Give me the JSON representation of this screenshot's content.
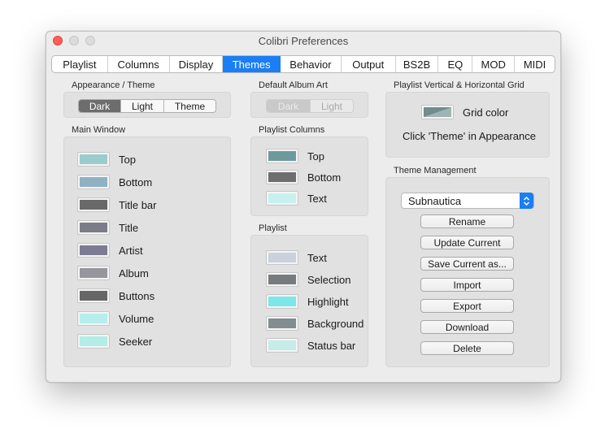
{
  "window": {
    "title": "Colibri Preferences"
  },
  "tabs": [
    {
      "label": "Playlist",
      "active": false
    },
    {
      "label": "Columns",
      "active": false
    },
    {
      "label": "Display",
      "active": false
    },
    {
      "label": "Themes",
      "active": true
    },
    {
      "label": "Behavior",
      "active": false
    },
    {
      "label": "Output",
      "active": false
    },
    {
      "label": "BS2B",
      "active": false
    },
    {
      "label": "EQ",
      "active": false
    },
    {
      "label": "MOD",
      "active": false
    },
    {
      "label": "MIDI",
      "active": false
    }
  ],
  "appearance": {
    "label": "Appearance / Theme",
    "options": [
      "Dark",
      "Light",
      "Theme"
    ],
    "selected": "Dark"
  },
  "main_window": {
    "label": "Main Window",
    "items": [
      {
        "label": "Top",
        "color": "#9ccbcb"
      },
      {
        "label": "Bottom",
        "color": "#8fb1c4"
      },
      {
        "label": "Title bar",
        "color": "#696969"
      },
      {
        "label": "Title",
        "color": "#7c7c88"
      },
      {
        "label": "Artist",
        "color": "#7d7b94"
      },
      {
        "label": "Album",
        "color": "#96969c"
      },
      {
        "label": "Buttons",
        "color": "#666666"
      },
      {
        "label": "Volume",
        "color": "#b6eeec"
      },
      {
        "label": "Seeker",
        "color": "#b2ede8"
      }
    ]
  },
  "default_album_art": {
    "label": "Default Album Art",
    "options": [
      "Dark",
      "Light"
    ],
    "selected": "Dark"
  },
  "playlist_columns": {
    "label": "Playlist Columns",
    "items": [
      {
        "label": "Top",
        "color": "#6e999c"
      },
      {
        "label": "Bottom",
        "color": "#6e6e6e"
      },
      {
        "label": "Text",
        "color": "#c7f1ee"
      }
    ]
  },
  "playlist": {
    "label": "Playlist",
    "items": [
      {
        "label": "Text",
        "color": "#c9d2da"
      },
      {
        "label": "Selection",
        "color": "#787b7e"
      },
      {
        "label": "Highlight",
        "color": "#7be7e9"
      },
      {
        "label": "Background",
        "color": "#818d8f"
      },
      {
        "label": "Status bar",
        "color": "#c5ece6"
      }
    ]
  },
  "grid": {
    "label": "Playlist Vertical & Horizontal Grid",
    "color_label": "Grid color",
    "color": "#6f8d8a",
    "hint": "Click 'Theme' in Appearance"
  },
  "theme_management": {
    "label": "Theme Management",
    "selected_theme": "Subnautica",
    "buttons": [
      "Rename",
      "Update Current",
      "Save Current as...",
      "Import",
      "Export",
      "Download",
      "Delete"
    ]
  },
  "colors": {
    "accent": "#1b7ef5"
  }
}
